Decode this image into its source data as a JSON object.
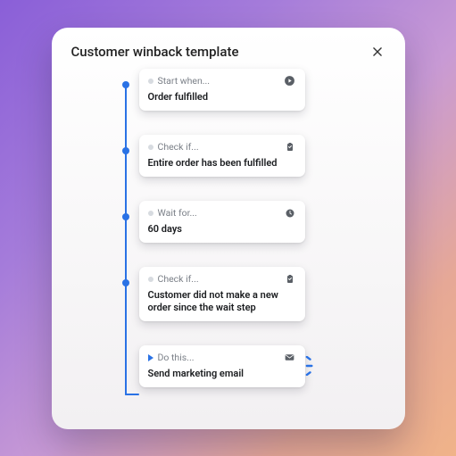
{
  "colors": {
    "accent": "#2a72e5"
  },
  "modal": {
    "title": "Customer winback template",
    "close_label": "Close"
  },
  "steps": [
    {
      "kind": "start",
      "label": "Start when...",
      "desc": "Order fulfilled",
      "icon": "play-circle"
    },
    {
      "kind": "check",
      "label": "Check if...",
      "desc": "Entire order has been fulfilled",
      "icon": "clipboard"
    },
    {
      "kind": "wait",
      "label": "Wait for...",
      "desc": "60 days",
      "icon": "clock"
    },
    {
      "kind": "check",
      "label": "Check if...",
      "desc": "Customer did not make a new order since the wait step",
      "icon": "clipboard"
    },
    {
      "kind": "do",
      "label": "Do this...",
      "desc": "Send marketing email",
      "icon": "mail"
    }
  ]
}
